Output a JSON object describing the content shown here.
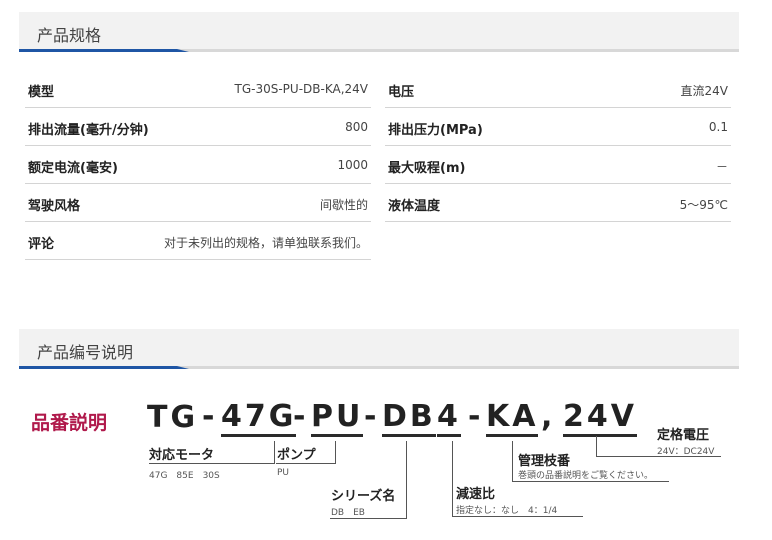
{
  "section1": {
    "title": "产品规格"
  },
  "specs": {
    "left": [
      {
        "label": "模型",
        "value": "TG-30S-PU-DB-KA,24V"
      },
      {
        "label": "排出流量(毫升/分钟)",
        "value": "800"
      },
      {
        "label": "额定电流(毫安)",
        "value": "1000"
      },
      {
        "label": "驾驶风格",
        "value": "间歇性的"
      },
      {
        "label": "评论",
        "value": "对于未列出的规格，请单独联系我们。"
      }
    ],
    "right": [
      {
        "label": "电压",
        "value": "直流24V"
      },
      {
        "label": "排出压力(MPa)",
        "value": "0.1"
      },
      {
        "label": "最大吸程(m)",
        "value": "－"
      },
      {
        "label": "液体温度",
        "value": "5～95℃"
      }
    ]
  },
  "section2": {
    "title": "产品编号说明"
  },
  "part_number": {
    "title": "品番説明",
    "segments": {
      "tg": "TG",
      "s1": "-",
      "motor": "47G",
      "s2": "-",
      "pump": "PU",
      "s3": "-",
      "series": "DB",
      "ratio": "4",
      "s4": "-",
      "mgmt": "KA",
      "s5": ",",
      "voltage": "24V"
    },
    "captions": {
      "motor": {
        "title": "対応モータ",
        "sub": "47G　85E　30S"
      },
      "pump": {
        "title": "ポンプ",
        "sub": "PU"
      },
      "series": {
        "title": "シリーズ名",
        "sub": "DB　EB"
      },
      "ratio": {
        "title": "減速比",
        "sub": "指定なし：なし　4：1/4"
      },
      "mgmt": {
        "title": "管理枝番",
        "sub": "巻頭の品番説明をご覧ください。"
      },
      "voltage": {
        "title": "定格電圧",
        "sub": "24V：DC24V"
      }
    }
  }
}
